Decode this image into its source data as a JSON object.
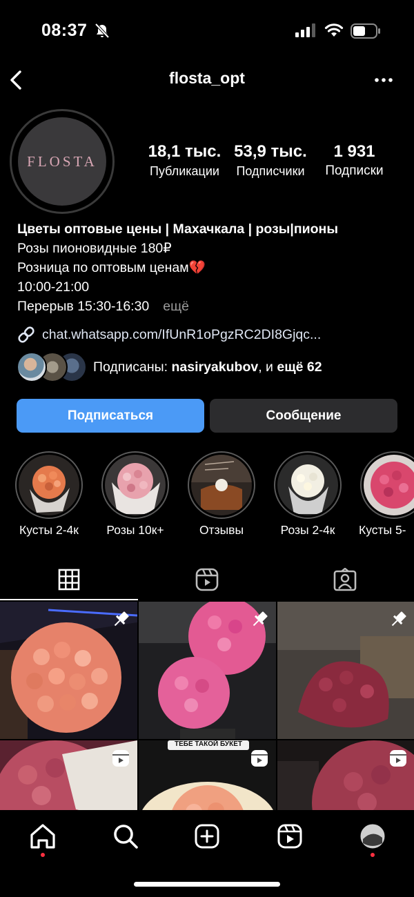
{
  "status_bar": {
    "time": "08:37"
  },
  "header": {
    "username": "flosta_opt"
  },
  "profile": {
    "avatar_text": "FLOSTA",
    "stats": [
      {
        "value": "18,1 тыс.",
        "label": "Публикации"
      },
      {
        "value": "53,9 тыс.",
        "label": "Подписчики"
      },
      {
        "value": "1 931",
        "label": "Подписки"
      }
    ],
    "bio": {
      "name": "Цветы оптовые цены | Махачкала | розы|пионы",
      "line1": "Розы пионовидные 180₽",
      "line2": "Розница по оптовым ценам💔",
      "line3": "10:00-21:00",
      "line4": "Перерыв 15:30-16:30",
      "more": "ещё"
    },
    "link": "chat.whatsapp.com/IfUnR1oPgzRC2DI8Gjqc...",
    "followed_by": {
      "prefix": "Подписаны:",
      "name": "nasiryakubov",
      "middle": ", и",
      "rest": "ещё 62"
    }
  },
  "buttons": {
    "follow": "Подписаться",
    "message": "Сообщение"
  },
  "highlights": [
    {
      "label": "Кусты 2-4к"
    },
    {
      "label": "Розы 10к+"
    },
    {
      "label": "Отзывы"
    },
    {
      "label": "Розы 2-4к"
    },
    {
      "label": "Кусты 5-"
    }
  ],
  "tabs": [
    "grid-icon",
    "reels-icon",
    "tagged-icon"
  ],
  "posts": [
    {
      "badge": "pin-icon"
    },
    {
      "badge": "pin-icon"
    },
    {
      "badge": "pin-icon"
    },
    {
      "badge": "reels-icon"
    },
    {
      "badge": "reels-icon",
      "overlay_text": "ТЕБЕ ТАКОЙ БУКЕТ"
    },
    {
      "badge": "reels-icon"
    }
  ],
  "bottom_nav": [
    "home-icon",
    "search-icon",
    "create-icon",
    "reels-icon",
    "profile-avatar"
  ],
  "colors": {
    "accent": "#4b9af6",
    "button_dark": "#2c2c2e",
    "notification": "#ff3040"
  }
}
